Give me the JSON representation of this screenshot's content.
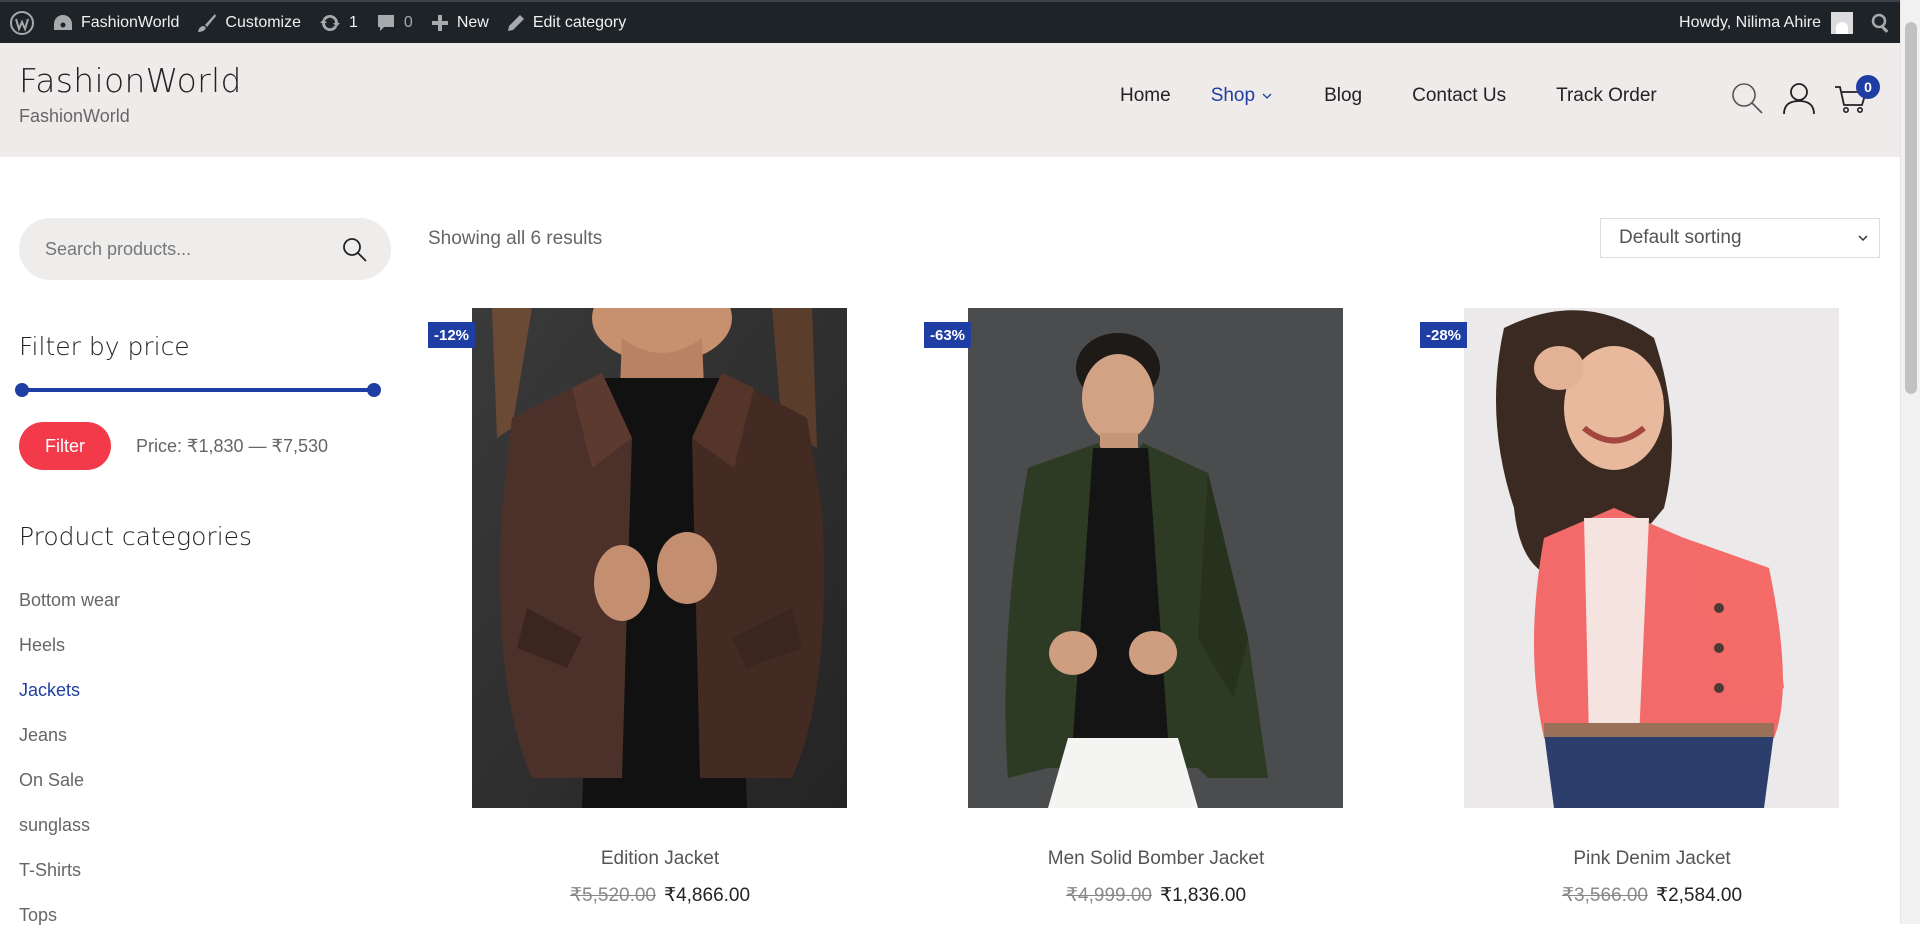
{
  "adminbar": {
    "site_name": "FashionWorld",
    "customize": "Customize",
    "updates_count": "1",
    "comments_count": "0",
    "new_label": "New",
    "edit_label": "Edit category",
    "howdy": "Howdy, Nilima Ahire"
  },
  "header": {
    "title": "FashionWorld",
    "tagline": "FashionWorld",
    "nav": [
      {
        "label": "Home"
      },
      {
        "label": "Shop"
      },
      {
        "label": "Blog"
      },
      {
        "label": "Contact Us"
      },
      {
        "label": "Track Order"
      }
    ],
    "cart_count": "0"
  },
  "sidebar": {
    "search_placeholder": "Search products...",
    "filter_title": "Filter by price",
    "filter_button": "Filter",
    "price_label": "Price: ₹1,830 — ₹7,530",
    "categories_title": "Product categories",
    "categories": [
      {
        "label": "Bottom wear"
      },
      {
        "label": "Heels"
      },
      {
        "label": "Jackets"
      },
      {
        "label": "Jeans"
      },
      {
        "label": "On Sale"
      },
      {
        "label": "sunglass"
      },
      {
        "label": "T-Shirts"
      },
      {
        "label": "Tops"
      }
    ]
  },
  "main": {
    "result_count": "Showing all 6 results",
    "sort_selected": "Default sorting",
    "products": [
      {
        "badge": "-12%",
        "name": "Edition Jacket",
        "old_price": "₹5,520.00",
        "price": "₹4,866.00"
      },
      {
        "badge": "-63%",
        "name": "Men Solid Bomber Jacket",
        "old_price": "₹4,999.00",
        "price": "₹1,836.00"
      },
      {
        "badge": "-28%",
        "name": "Pink Denim Jacket",
        "old_price": "₹3,566.00",
        "price": "₹2,584.00"
      }
    ]
  },
  "colors": {
    "accent": "#1f3ea3",
    "filter_button": "#f23a4a",
    "header_bg": "#efebea",
    "adminbar_bg": "#1d2327"
  }
}
